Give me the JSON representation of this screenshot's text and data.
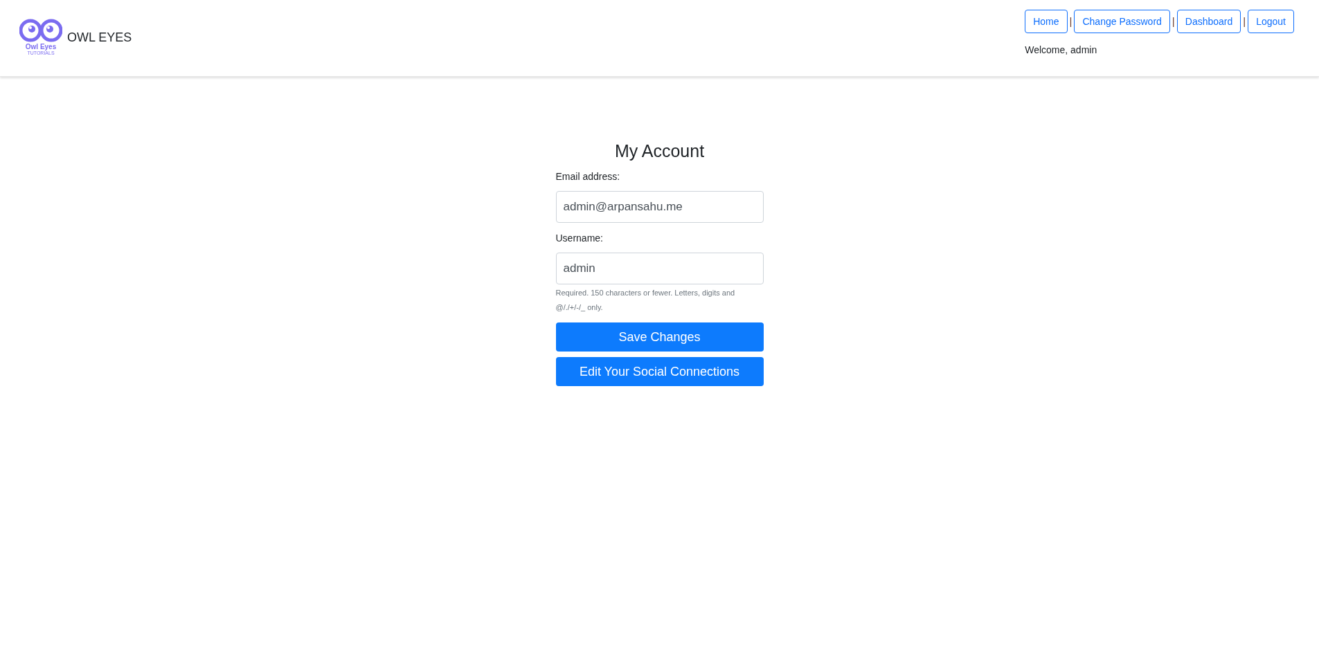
{
  "header": {
    "logo": {
      "name": "Owl Eyes",
      "tagline": "TUTORIALS"
    },
    "brand": "OWL EYES",
    "nav": [
      {
        "label": "Home"
      },
      {
        "label": "Change Password"
      },
      {
        "label": "Dashboard"
      },
      {
        "label": "Logout"
      }
    ],
    "separator": "|",
    "welcome": "Welcome, admin"
  },
  "form": {
    "title": "My Account",
    "fields": [
      {
        "label": "Email address:",
        "value": "admin@arpansahu.me"
      },
      {
        "label": "Username:",
        "value": "admin",
        "help": "Required. 150 characters or fewer. Letters, digits and @/./+/-/_ only."
      }
    ],
    "buttons": [
      "Save Changes",
      "Edit Your Social Connections"
    ]
  }
}
